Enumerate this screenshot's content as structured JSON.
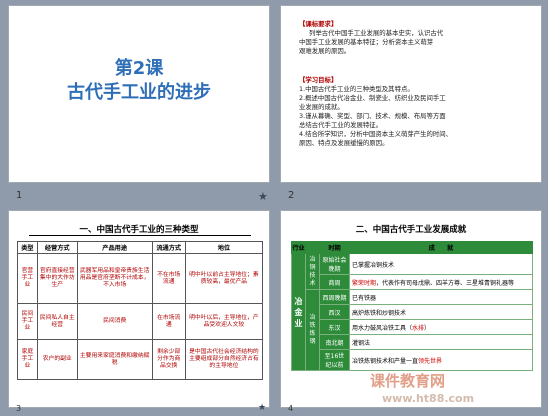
{
  "slides": {
    "s1": {
      "number": "1",
      "title_line1": "第2课",
      "title_line2": "古代手工业的进步"
    },
    "s2": {
      "number": "2",
      "req_header": "【课标要求】",
      "req_lines": [
        "列举古代中国手工业发展的基本史实，认识古代",
        "中国手工业发展的基本特征；分析资本主义萌芽",
        "艰难发展的原因。"
      ],
      "goal_header": "【学习目标】",
      "goal_lines": [
        "1.中国古代手工业的三种类型及其特点。",
        "2.概述中国古代冶金业、制瓷业、纺织业及民间手工",
        "业发展的成就。",
        "3.谨从幕确、奖型、部门、技术、规模、布局等方面",
        "总结古代手工业的发展特征。",
        "4.结合所学知识，分析中国资本主义萌芽产生的时间、",
        "原因、特点及发展缓慢的原因。"
      ]
    },
    "s3": {
      "number": "3",
      "heading": "一、中国古代手工业的三种类型",
      "headers": [
        "类型",
        "经营方式",
        "产品用途",
        "流通方式",
        "地位"
      ],
      "rows": [
        [
          "官营手工业",
          "官府直接经营集中的大作坊生产",
          "武器军用品和皇帝贵族生活用品是官府垄断不计成本，不入市场",
          "不在市场流通",
          "明中叶以前占主导地位；素质较高，最优产品"
        ],
        [
          "民间手工业",
          "民间私人自主经营",
          "民间消费",
          "在市场流通",
          "明中叶以后，主导地位，产品受欢迎人文较"
        ],
        [
          "家庭手工业",
          "农户的副业",
          "主要用来家庭消费和缴纳赋税",
          "剩余少部分作为商品交换",
          "是中国古代社会经济结构的主要组成部分自然经济占有的主导地位"
        ]
      ]
    },
    "s4": {
      "number": "4",
      "heading": "二、中国古代手工业发展成就",
      "headers": [
        "行业",
        "时期",
        "成　　就"
      ],
      "industry": "冶金业",
      "rows": [
        {
          "cat": "冶铜技术",
          "period": "原始社会晚期",
          "achievement": "已掌握冶铜技术",
          "highlight": ""
        },
        {
          "cat": "",
          "period": "商周",
          "achievement": "代表作有司母戊鼎、四羊方尊、三星堆青铜礼器等",
          "highlight": "繁荣时期"
        },
        {
          "cat": "冶铁炼钢",
          "period": "西周晚期",
          "achievement": "已有铁器",
          "highlight": ""
        },
        {
          "cat": "",
          "period": "西汉",
          "achievement": "高炉炼铁和炒钢技术",
          "highlight": ""
        },
        {
          "cat": "",
          "period": "东汉",
          "achievement": "用水力鼓风冶铁工具（",
          "highlight": "水排"
        },
        {
          "cat": "",
          "period": "南北朝",
          "achievement": "灌钢法",
          "highlight": ""
        },
        {
          "cat": "",
          "period": "至16世纪以前",
          "achievement": "冶铁炼钢技术和产量一直",
          "highlight": "领先世界"
        }
      ]
    }
  },
  "watermark": {
    "line1": "课件教育网",
    "line2": "www.ht88.com"
  },
  "colors": {
    "accent_blue": "#2f6fb8",
    "accent_red": "#b00000",
    "green": "#2e8b3a"
  }
}
